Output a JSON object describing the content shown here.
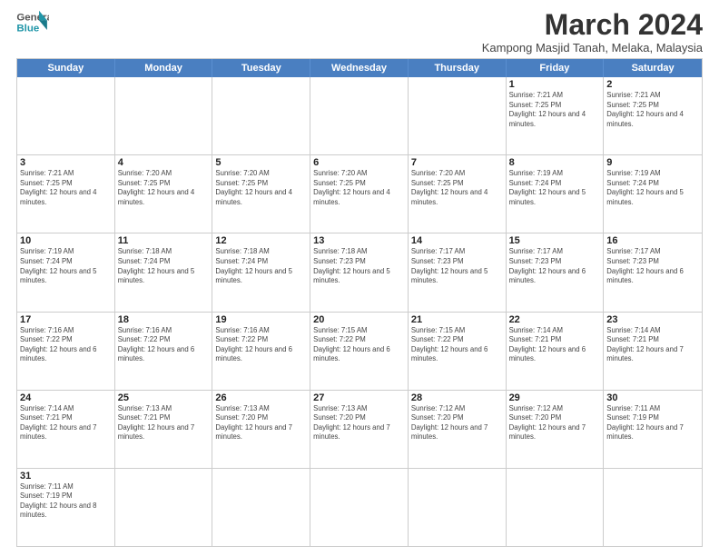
{
  "header": {
    "logo_general": "General",
    "logo_blue": "Blue",
    "month_title": "March 2024",
    "subtitle": "Kampong Masjid Tanah, Melaka, Malaysia"
  },
  "weekdays": [
    "Sunday",
    "Monday",
    "Tuesday",
    "Wednesday",
    "Thursday",
    "Friday",
    "Saturday"
  ],
  "rows": [
    [
      {
        "day": "",
        "info": ""
      },
      {
        "day": "",
        "info": ""
      },
      {
        "day": "",
        "info": ""
      },
      {
        "day": "",
        "info": ""
      },
      {
        "day": "",
        "info": ""
      },
      {
        "day": "1",
        "info": "Sunrise: 7:21 AM\nSunset: 7:25 PM\nDaylight: 12 hours and 4 minutes."
      },
      {
        "day": "2",
        "info": "Sunrise: 7:21 AM\nSunset: 7:25 PM\nDaylight: 12 hours and 4 minutes."
      }
    ],
    [
      {
        "day": "3",
        "info": "Sunrise: 7:21 AM\nSunset: 7:25 PM\nDaylight: 12 hours and 4 minutes."
      },
      {
        "day": "4",
        "info": "Sunrise: 7:20 AM\nSunset: 7:25 PM\nDaylight: 12 hours and 4 minutes."
      },
      {
        "day": "5",
        "info": "Sunrise: 7:20 AM\nSunset: 7:25 PM\nDaylight: 12 hours and 4 minutes."
      },
      {
        "day": "6",
        "info": "Sunrise: 7:20 AM\nSunset: 7:25 PM\nDaylight: 12 hours and 4 minutes."
      },
      {
        "day": "7",
        "info": "Sunrise: 7:20 AM\nSunset: 7:25 PM\nDaylight: 12 hours and 4 minutes."
      },
      {
        "day": "8",
        "info": "Sunrise: 7:19 AM\nSunset: 7:24 PM\nDaylight: 12 hours and 5 minutes."
      },
      {
        "day": "9",
        "info": "Sunrise: 7:19 AM\nSunset: 7:24 PM\nDaylight: 12 hours and 5 minutes."
      }
    ],
    [
      {
        "day": "10",
        "info": "Sunrise: 7:19 AM\nSunset: 7:24 PM\nDaylight: 12 hours and 5 minutes."
      },
      {
        "day": "11",
        "info": "Sunrise: 7:18 AM\nSunset: 7:24 PM\nDaylight: 12 hours and 5 minutes."
      },
      {
        "day": "12",
        "info": "Sunrise: 7:18 AM\nSunset: 7:24 PM\nDaylight: 12 hours and 5 minutes."
      },
      {
        "day": "13",
        "info": "Sunrise: 7:18 AM\nSunset: 7:23 PM\nDaylight: 12 hours and 5 minutes."
      },
      {
        "day": "14",
        "info": "Sunrise: 7:17 AM\nSunset: 7:23 PM\nDaylight: 12 hours and 5 minutes."
      },
      {
        "day": "15",
        "info": "Sunrise: 7:17 AM\nSunset: 7:23 PM\nDaylight: 12 hours and 6 minutes."
      },
      {
        "day": "16",
        "info": "Sunrise: 7:17 AM\nSunset: 7:23 PM\nDaylight: 12 hours and 6 minutes."
      }
    ],
    [
      {
        "day": "17",
        "info": "Sunrise: 7:16 AM\nSunset: 7:22 PM\nDaylight: 12 hours and 6 minutes."
      },
      {
        "day": "18",
        "info": "Sunrise: 7:16 AM\nSunset: 7:22 PM\nDaylight: 12 hours and 6 minutes."
      },
      {
        "day": "19",
        "info": "Sunrise: 7:16 AM\nSunset: 7:22 PM\nDaylight: 12 hours and 6 minutes."
      },
      {
        "day": "20",
        "info": "Sunrise: 7:15 AM\nSunset: 7:22 PM\nDaylight: 12 hours and 6 minutes."
      },
      {
        "day": "21",
        "info": "Sunrise: 7:15 AM\nSunset: 7:22 PM\nDaylight: 12 hours and 6 minutes."
      },
      {
        "day": "22",
        "info": "Sunrise: 7:14 AM\nSunset: 7:21 PM\nDaylight: 12 hours and 6 minutes."
      },
      {
        "day": "23",
        "info": "Sunrise: 7:14 AM\nSunset: 7:21 PM\nDaylight: 12 hours and 7 minutes."
      }
    ],
    [
      {
        "day": "24",
        "info": "Sunrise: 7:14 AM\nSunset: 7:21 PM\nDaylight: 12 hours and 7 minutes."
      },
      {
        "day": "25",
        "info": "Sunrise: 7:13 AM\nSunset: 7:21 PM\nDaylight: 12 hours and 7 minutes."
      },
      {
        "day": "26",
        "info": "Sunrise: 7:13 AM\nSunset: 7:20 PM\nDaylight: 12 hours and 7 minutes."
      },
      {
        "day": "27",
        "info": "Sunrise: 7:13 AM\nSunset: 7:20 PM\nDaylight: 12 hours and 7 minutes."
      },
      {
        "day": "28",
        "info": "Sunrise: 7:12 AM\nSunset: 7:20 PM\nDaylight: 12 hours and 7 minutes."
      },
      {
        "day": "29",
        "info": "Sunrise: 7:12 AM\nSunset: 7:20 PM\nDaylight: 12 hours and 7 minutes."
      },
      {
        "day": "30",
        "info": "Sunrise: 7:11 AM\nSunset: 7:19 PM\nDaylight: 12 hours and 7 minutes."
      }
    ],
    [
      {
        "day": "31",
        "info": "Sunrise: 7:11 AM\nSunset: 7:19 PM\nDaylight: 12 hours and 8 minutes."
      },
      {
        "day": "",
        "info": ""
      },
      {
        "day": "",
        "info": ""
      },
      {
        "day": "",
        "info": ""
      },
      {
        "day": "",
        "info": ""
      },
      {
        "day": "",
        "info": ""
      },
      {
        "day": "",
        "info": ""
      }
    ]
  ]
}
